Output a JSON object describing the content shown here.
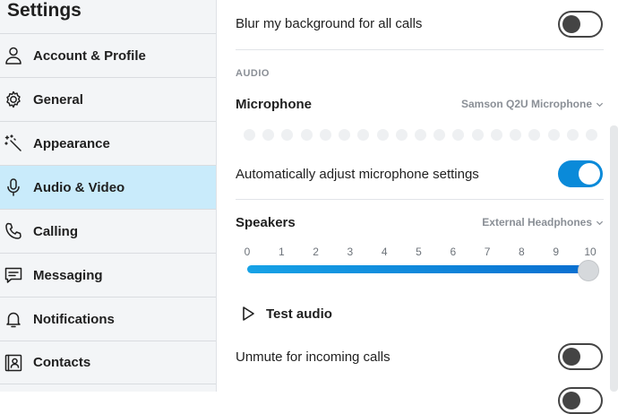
{
  "sidebar": {
    "title": "Settings",
    "items": [
      {
        "label": "Account & Profile",
        "icon": "person-icon"
      },
      {
        "label": "General",
        "icon": "gear-icon"
      },
      {
        "label": "Appearance",
        "icon": "magic-wand-icon"
      },
      {
        "label": "Audio & Video",
        "icon": "microphone-icon",
        "selected": true
      },
      {
        "label": "Calling",
        "icon": "phone-icon"
      },
      {
        "label": "Messaging",
        "icon": "chat-icon"
      },
      {
        "label": "Notifications",
        "icon": "bell-icon"
      },
      {
        "label": "Contacts",
        "icon": "contact-card-icon"
      }
    ]
  },
  "main": {
    "blur_background": {
      "label": "Blur my background for all calls",
      "enabled": false
    },
    "audio_section_label": "AUDIO",
    "microphone": {
      "heading": "Microphone",
      "device": "Samson Q2U Microphone",
      "level_dots": 19
    },
    "auto_adjust": {
      "label": "Automatically adjust microphone settings",
      "enabled": true
    },
    "speakers": {
      "heading": "Speakers",
      "device": "External Headphones",
      "scale": [
        "0",
        "1",
        "2",
        "3",
        "4",
        "5",
        "6",
        "7",
        "8",
        "9",
        "10"
      ],
      "volume": 10
    },
    "test_audio": {
      "label": "Test audio"
    },
    "unmute_incoming": {
      "label": "Unmute for incoming calls",
      "enabled": false
    }
  },
  "colors": {
    "accent": "#0a8ad9",
    "selected_bg": "#c9ebfb",
    "sidebar_bg": "#f3f5f7"
  }
}
